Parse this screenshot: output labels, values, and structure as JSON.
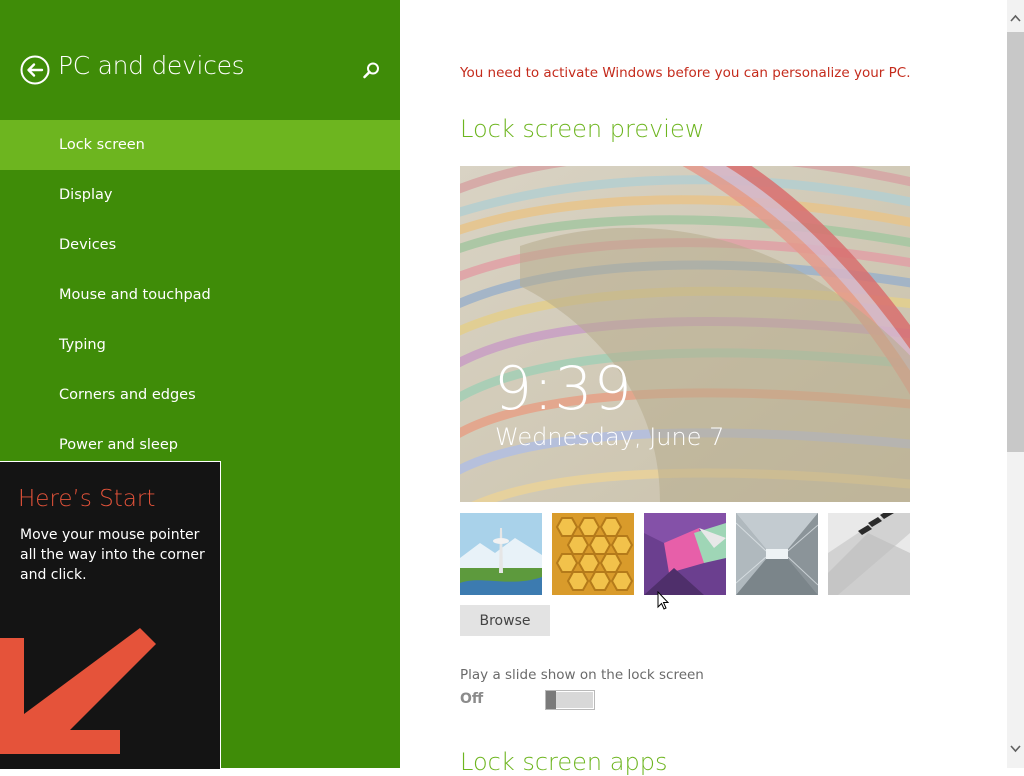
{
  "sidebar": {
    "title": "PC and devices",
    "back_icon": "back-arrow-circle-icon",
    "search_icon": "search-icon",
    "items": [
      {
        "label": "Lock screen",
        "active": true
      },
      {
        "label": "Display",
        "active": false
      },
      {
        "label": "Devices",
        "active": false
      },
      {
        "label": "Mouse and touchpad",
        "active": false
      },
      {
        "label": "Typing",
        "active": false
      },
      {
        "label": "Corners and edges",
        "active": false
      },
      {
        "label": "Power and sleep",
        "active": false
      }
    ],
    "colors": {
      "background": "#3f8c08",
      "active_item": "#6db51f"
    }
  },
  "start_tip": {
    "title": "Here’s Start",
    "text": "Move your mouse pointer all the way into the corner and click.",
    "arrow_icon": "down-left-arrow-icon",
    "colors": {
      "title": "#e5533a",
      "arrow": "#e5533a"
    }
  },
  "main": {
    "activation_warning": "You need to activate Windows before you can personalize your PC.",
    "preview_title": "Lock screen preview",
    "preview": {
      "time": "9:39",
      "date": "Wednesday, June 7"
    },
    "thumbnails": [
      {
        "name": "space-needle"
      },
      {
        "name": "honeycomb"
      },
      {
        "name": "geometric-shapes"
      },
      {
        "name": "tunnel"
      },
      {
        "name": "piano-keys"
      }
    ],
    "browse_label": "Browse",
    "slideshow_label": "Play a slide show on the lock screen",
    "slideshow_state": "Off",
    "slideshow_on": false,
    "next_section_title": "Lock screen apps",
    "colors": {
      "warning": "#c42b1c",
      "section_title": "#6db51f"
    }
  },
  "scrollbar": {
    "up_icon": "chevron-up-icon",
    "down_icon": "chevron-down-icon"
  }
}
